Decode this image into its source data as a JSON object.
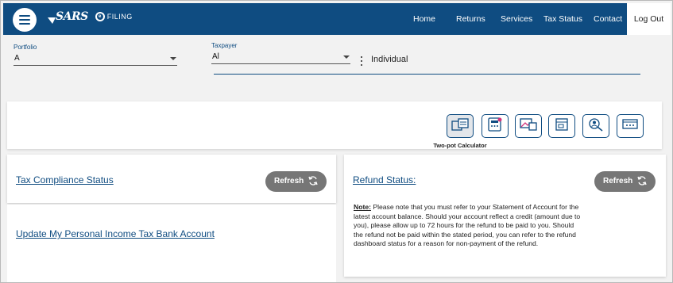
{
  "header": {
    "logo_text": "SARS",
    "logo_sub": "FILING",
    "nav": [
      "Home",
      "Returns",
      "Services",
      "Tax Status",
      "Contact"
    ],
    "logout_label": "Log Out"
  },
  "selectors": {
    "portfolio_label": "Portfolio",
    "portfolio_value": "A",
    "taxpayer_label": "Taxpayer",
    "taxpayer_value": "Al",
    "taxpayer_type": "Individual"
  },
  "tools": {
    "icons": [
      "two-pot-calculator-icon",
      "tax-calculator-icon",
      "gallery-icon",
      "document-icon",
      "user-search-icon",
      "monitor-icon"
    ],
    "active_caption": "Two-pot Calculator"
  },
  "tax_compliance": {
    "title": "Tax Compliance Status",
    "refresh_label": "Refresh"
  },
  "bank_account": {
    "title": "Update My Personal Income Tax Bank Account"
  },
  "refund": {
    "title": "Refund Status:",
    "refresh_label": "Refresh",
    "note_label": "Note:",
    "note_text": " Please note that you must refer to your Statement of Account for the latest account balance. Should your account reflect a credit (amount due to you), please allow up to 72 hours for the refund to be paid to you. Should the refund not be paid within the stated period, you can refer to the refund dashboard status for a reason for non-payment of the refund."
  },
  "colors": {
    "brand_blue": "#0f4c81",
    "button_grey": "#767676"
  }
}
